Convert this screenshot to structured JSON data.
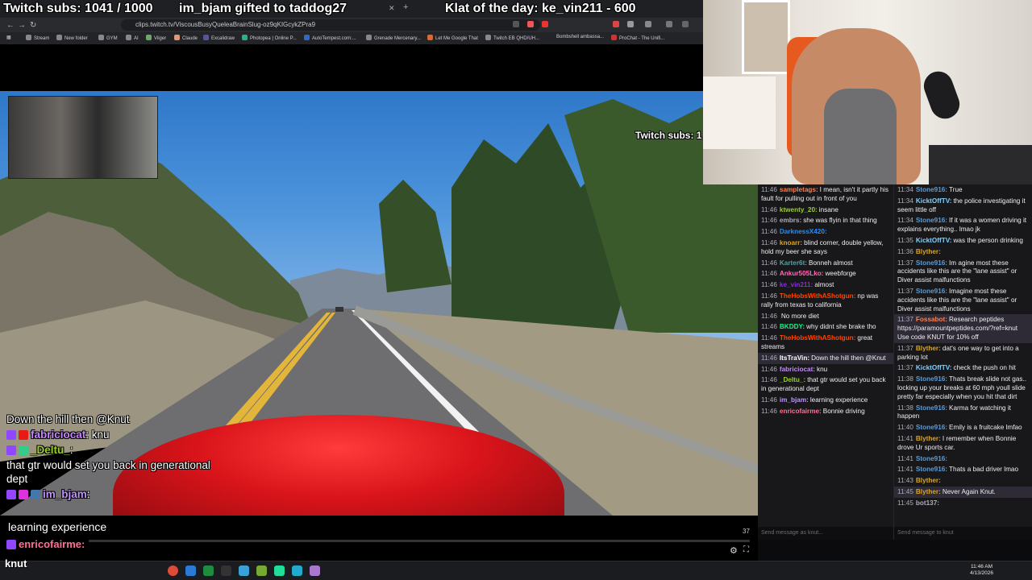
{
  "overlay": {
    "subs_text": "Twitch subs: 1041 / 1000",
    "gifted_text": "im_bjam gifted to taddog27",
    "klat_text": "Klat of the day: ke_vin211 - 600",
    "video_subs_text": "Twitch subs: 1"
  },
  "browser": {
    "url": "clips.twitch.tv/ViscousBusyQueleaBrainSlug-oz9qKIGcykZPra9",
    "bookmarks": [
      "Stream",
      "New folder",
      "GYM",
      "AI",
      "Viiger",
      "Claude",
      "Excalidraw",
      "Photopea | Online P...",
      "AutoTempest.com:...",
      "Grenade Mercenary...",
      "Let Me Google That",
      "Twitch EB QHD/UH...",
      "Bombshell ambassa...",
      "ProChat - The Unifi..."
    ]
  },
  "video_chat": [
    {
      "user": "",
      "text": "Down the hill then @Knut"
    },
    {
      "user": "fabriciocat",
      "text": ": knu"
    },
    {
      "user": "_Deltu_",
      "text": ":"
    },
    {
      "user": "",
      "text": "that gtr would set you back in generational dept"
    },
    {
      "user": "im_bjam",
      "text": ":"
    },
    {
      "user": "",
      "text": "learning experience"
    },
    {
      "user": "enricofairme",
      "text": ":"
    },
    {
      "user": "",
      "text": "Bonnie driving"
    }
  ],
  "player": {
    "timecode": "37",
    "learning_text": "learning experience",
    "progress": 0.0
  },
  "chat_left": [
    {
      "time": "11:46",
      "user": "sampletags:",
      "color": "#ff7f50",
      "text": "I mean, isn't it partly his fault for pulling out in front of you"
    },
    {
      "time": "11:46",
      "user": "ktwenty_20:",
      "color": "#9acd32",
      "text": "insane"
    },
    {
      "time": "11:46",
      "user": "embrs:",
      "color": "#adadb8",
      "text": "she was flyin in that thing"
    },
    {
      "time": "11:46",
      "user": "DarknessX420:",
      "color": "#1e90ff",
      "text": ""
    },
    {
      "time": "11:46",
      "user": "knoarr:",
      "color": "#daa520",
      "text": "blind corner, double yellow, hold my beer she says"
    },
    {
      "time": "11:46",
      "user": "Karter6t:",
      "color": "#5f9ea0",
      "text": "Bonneh almost"
    },
    {
      "time": "11:46",
      "user": "Ankur505Lko:",
      "color": "#ff69b4",
      "text": "weebforge"
    },
    {
      "time": "11:46",
      "user": "ke_vin211:",
      "color": "#8a2be2",
      "text": "almost"
    },
    {
      "time": "11:46",
      "user": "TheHobsWithAShotgun:",
      "color": "#ff4500",
      "text": "np was rally from texas to california"
    },
    {
      "time": "11:46",
      "user": "",
      "color": "#ff0000",
      "text": "No more diet"
    },
    {
      "time": "11:46",
      "user": "BKDDY:",
      "color": "#00ff7f",
      "text": "why didnt she brake tho"
    },
    {
      "time": "11:46",
      "user": "TheHobsWithAShotgun:",
      "color": "#ff4500",
      "text": "great streams"
    },
    {
      "time": "11:46",
      "user": "ItsTraVin:",
      "color": "#ffffff",
      "text": "Down the hill then @Knut",
      "highlight": true
    },
    {
      "time": "11:46",
      "user": "fabriciocat:",
      "color": "#c586ff",
      "text": "knu"
    },
    {
      "time": "11:46",
      "user": "_Deltu_:",
      "color": "#9acd32",
      "text": "that gtr would set you back in generational dept"
    },
    {
      "time": "11:46",
      "user": "im_bjam:",
      "color": "#bf94ff",
      "text": "learning experience"
    },
    {
      "time": "11:46",
      "user": "enricofairme:",
      "color": "#ff6f91",
      "text": "Bonnie driving"
    }
  ],
  "chat_right": [
    {
      "time": "11:34",
      "user": "Stone916:",
      "color": "#5b9bd5",
      "text": "True"
    },
    {
      "time": "11:34",
      "user": "KicktOffTV:",
      "color": "#7fd1ff",
      "text": "the police investigating it seem little off"
    },
    {
      "time": "11:34",
      "user": "Stone916:",
      "color": "#5b9bd5",
      "text": "If it was a women driving it explains everything.. lmao jk"
    },
    {
      "time": "11:35",
      "user": "KicktOffTV:",
      "color": "#7fd1ff",
      "text": "was the person drinking"
    },
    {
      "time": "11:36",
      "user": "Blyther:",
      "color": "#daa520",
      "text": ""
    },
    {
      "time": "11:37",
      "user": "Stone916:",
      "color": "#5b9bd5",
      "text": "Im agine most these accidents like this are the \"lane assist\" or Diver assist malfunctions"
    },
    {
      "time": "11:37",
      "user": "Stone916:",
      "color": "#5b9bd5",
      "text": "Imagine most these accidents like this are the \"lane assist\" or Diver assist malfunctions"
    },
    {
      "time": "11:37",
      "user": "Fossabot:",
      "color": "#ff7f50",
      "text": "Research peptides https://paramountpeptides.com/?ref=knut Use code KNUT for 10% off",
      "highlight": true
    },
    {
      "time": "11:37",
      "user": "Blyther:",
      "color": "#daa520",
      "text": "dat's one way to get into a parking lot"
    },
    {
      "time": "11:37",
      "user": "KicktOffTV:",
      "color": "#7fd1ff",
      "text": "check the push on hit"
    },
    {
      "time": "11:38",
      "user": "Stone916:",
      "color": "#5b9bd5",
      "text": "Thats break slide not gas.. locking up your breaks at 60 mph youll slide pretty far especially when you hit that dirt"
    },
    {
      "time": "11:38",
      "user": "Stone916:",
      "color": "#5b9bd5",
      "text": "Karma for watching it happen"
    },
    {
      "time": "11:40",
      "user": "Stone916:",
      "color": "#5b9bd5",
      "text": "Emily is a fruitcake lmfao"
    },
    {
      "time": "11:41",
      "user": "Blyther:",
      "color": "#daa520",
      "text": "I remember when Bonnie drove Ur sports car."
    },
    {
      "time": "11:41",
      "user": "Stone916:",
      "color": "#5b9bd5",
      "text": ""
    },
    {
      "time": "11:41",
      "user": "Stone916:",
      "color": "#5b9bd5",
      "text": "Thats a bad driver lmao"
    },
    {
      "time": "11:43",
      "user": "Blyther:",
      "color": "#daa520",
      "text": ""
    },
    {
      "time": "11:45",
      "user": "Blyther:",
      "color": "#daa520",
      "text": "Never Again Knut.",
      "highlight": true
    },
    {
      "time": "11:45",
      "user": "bot137:",
      "color": "#adadb8",
      "text": ""
    }
  ],
  "chat_inputs": {
    "left_placeholder": "Send message as knut...",
    "right_placeholder": "Send message to knut"
  },
  "taskbar": {
    "time": "11:46 AM",
    "date": "4/13/2026",
    "label": "knut"
  },
  "colors": {
    "twitch_purple": "#9147ff",
    "chat_bg": "#18181b"
  }
}
